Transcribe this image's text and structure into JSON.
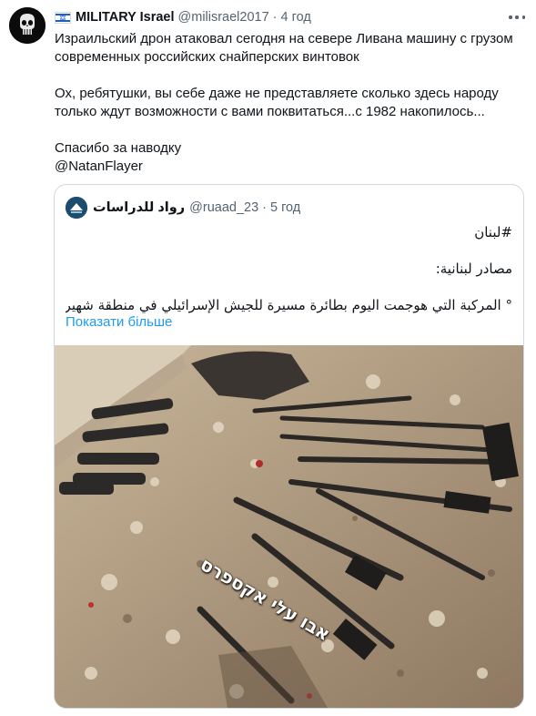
{
  "tweet": {
    "author": {
      "display_name": "MILITARY Israel",
      "handle": "@milisrael2017",
      "time": "4 год",
      "flag_icon": "israel-flag-icon",
      "avatar_icon": "punisher-skull-icon"
    },
    "text": {
      "line1": "Израильский дрон атаковал сегодня на севере Ливана машину с грузом",
      "line2": "современных российских снайперских винтовок",
      "line3": "Ох, ребятушки, вы себе даже не представляете сколько здесь народу",
      "line4": "только ждут возможности с вами поквитаться...с 1982 накопилось...",
      "line5": "Спасибо за наводку",
      "line6": "@NatanFlayer"
    },
    "more_icon": "more-dots-icon"
  },
  "quote": {
    "display_name": "رواد للدراسات",
    "handle": "@ruaad_23",
    "time": "5 год",
    "hashtag_line": "#لبنان",
    "source_line": "مصادر لبنانية:",
    "content_line": "° المركبة التي هوجمت اليوم بطائرة مسيرة للجيش الإسرائيلي في منطقة شهير...",
    "show_more": "Показати більше",
    "image": {
      "description_icon": "photo-weapons-rubble",
      "watermark": "אבו עלי אקספרס"
    }
  },
  "colors": {
    "text_primary": "#0f1419",
    "text_secondary": "#536471",
    "link": "#1d9bf0",
    "border": "#cfd9de"
  }
}
